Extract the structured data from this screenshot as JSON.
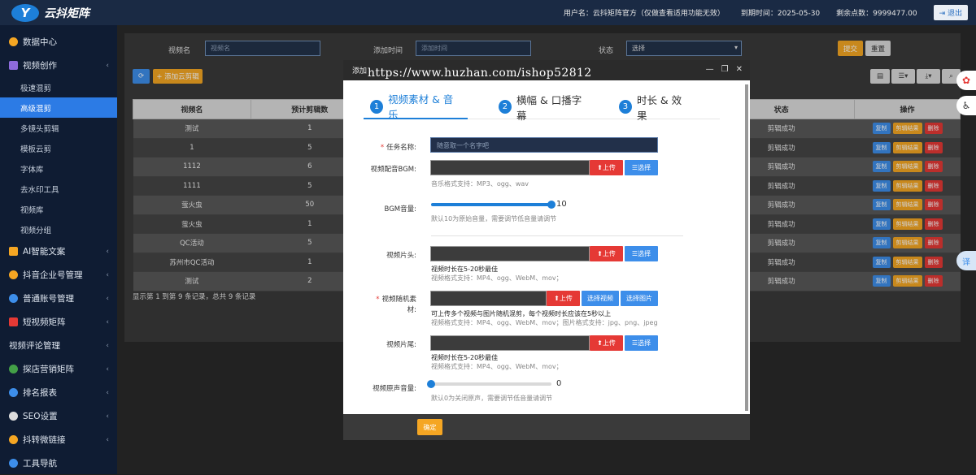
{
  "header": {
    "logo_letter": "Y",
    "logo_text": "云抖矩阵",
    "user_info": "用户名：云抖矩阵官方（仅做查看适用功能无效）",
    "expire": "到期时间：2025-05-30",
    "points": "剩余点数：9999477.00",
    "logout": "退出"
  },
  "sidebar": {
    "items": [
      {
        "label": "数据中心",
        "color": "#f5a623"
      },
      {
        "label": "视频创作",
        "color": "#8e6bdc"
      },
      {
        "label": "AI智能文案",
        "color": "#f5a623"
      },
      {
        "label": "抖音企业号管理",
        "color": "#f5a623"
      },
      {
        "label": "普通账号管理",
        "color": "#3d8eea"
      },
      {
        "label": "短视频矩阵",
        "color": "#e53935"
      },
      {
        "label": "视频评论管理",
        "color": ""
      },
      {
        "label": "探店营销矩阵",
        "color": "#43a047"
      },
      {
        "label": "排名报表",
        "color": "#3d8eea"
      },
      {
        "label": "SEO设置",
        "color": "#dddddd"
      },
      {
        "label": "抖转微链接",
        "color": "#f5a623"
      },
      {
        "label": "工具导航",
        "color": "#3d8eea"
      }
    ],
    "subitems": [
      "极速混剪",
      "高级混剪",
      "多镜头剪辑",
      "模板云剪",
      "字体库",
      "去水印工具",
      "视频库",
      "视频分组"
    ]
  },
  "filters": {
    "name_label": "视频名",
    "name_placeholder": "视频名",
    "time_label": "添加时间",
    "time_placeholder": "添加时间",
    "status_label": "状态",
    "status_value": "选择",
    "submit": "提交",
    "reset": "重置"
  },
  "toolbar": {
    "add": "+ 添加云剪辑"
  },
  "table": {
    "headers": [
      "视频名",
      "预计剪辑数",
      "状态",
      "操作"
    ],
    "rows": [
      {
        "name": "测试",
        "count": "1",
        "status": "剪辑成功"
      },
      {
        "name": "1",
        "count": "5",
        "status": "剪辑成功"
      },
      {
        "name": "1112",
        "count": "6",
        "status": "剪辑成功"
      },
      {
        "name": "1111",
        "count": "5",
        "status": "剪辑成功"
      },
      {
        "name": "萤火虫",
        "count": "50",
        "status": "剪辑成功"
      },
      {
        "name": "萤火虫",
        "count": "1",
        "status": "剪辑成功"
      },
      {
        "name": "QC活动",
        "count": "5",
        "status": "剪辑成功"
      },
      {
        "name": "苏州市QC活动",
        "count": "1",
        "status": "剪辑成功"
      },
      {
        "name": "测试",
        "count": "2",
        "status": "剪辑成功"
      }
    ],
    "op_copy": "复制",
    "op_result": "剪辑结果",
    "op_delete": "删除",
    "footer": "显示第 1 到第 9 条记录，总共 9 条记录"
  },
  "modal": {
    "title": "添加",
    "watermark": "https://www.huzhan.com/ishop52812",
    "steps": [
      {
        "num": "1",
        "label": "视频素材 & 音乐"
      },
      {
        "num": "2",
        "label": "横幅 & 口播字幕"
      },
      {
        "num": "3",
        "label": "时长 & 效果"
      }
    ],
    "task_label": "任务名称:",
    "task_placeholder": "随意取一个名字吧",
    "bgm_label": "视频配音BGM:",
    "upload": "上传",
    "choose": "选择",
    "bgm_hint": "音乐格式支持：MP3、ogg、wav",
    "bgm_vol_label": "BGM音量:",
    "bgm_vol_value": "10",
    "bgm_vol_level": 1.0,
    "bgm_vol_hint": "默认10为原始音量，需要调节低音量请调节",
    "head_label": "视频片头:",
    "head_hint1": "视频时长在5-20秒最佳",
    "head_hint2": "视频格式支持：MP4、ogg、WebM、mov；",
    "rand_label": "视频随机素材:",
    "choose_video": "选择视频",
    "choose_image": "选择图片",
    "rand_hint1": "可上传多个视频与图片随机混剪，每个视频时长应该在5秒以上",
    "rand_hint2": "视频格式支持：MP4、ogg、WebM、mov；图片格式支持：jpg、png、jpeg",
    "tail_label": "视频片尾:",
    "tail_hint1": "视频时长在5-20秒最佳",
    "tail_hint2": "视频格式支持：MP4、ogg、WebM、mov；",
    "orig_vol_label": "视频原声音量:",
    "orig_vol_value": "0",
    "orig_vol_level": 0.0,
    "orig_vol_hint": "默认0为关闭原声，需要调节低音量请调节",
    "confirm": "确定"
  }
}
